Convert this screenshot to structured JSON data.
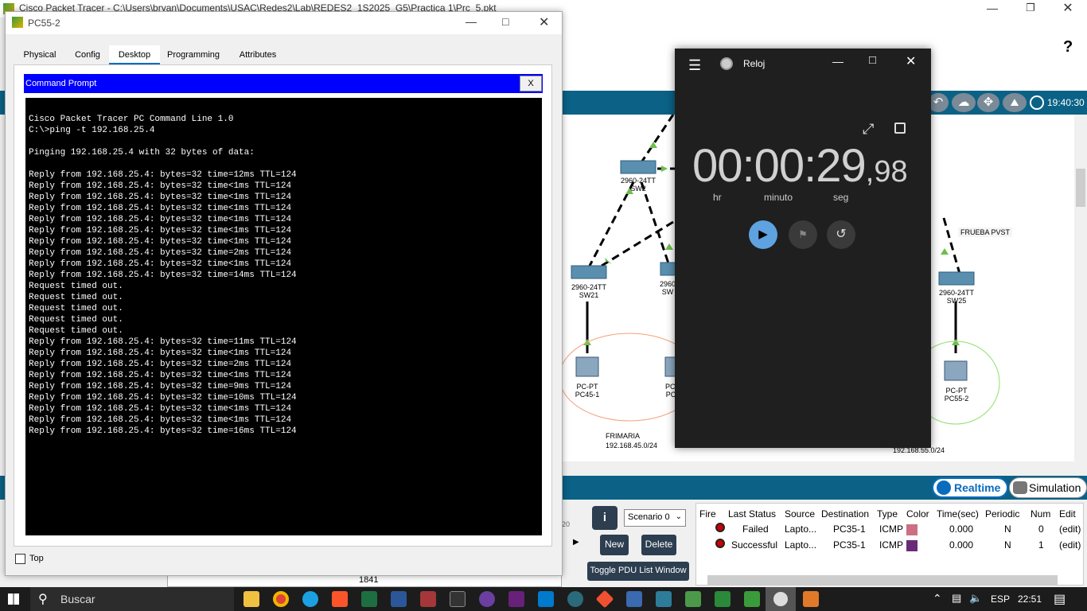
{
  "main_window": {
    "title": "Cisco Packet Tracer - C:\\Users\\bryan\\Documents\\USAC\\Redes2\\Lab\\REDES2_1S2025_G5\\Practica 1\\Prc_5.pkt",
    "help_label": "?",
    "time_display": "19:40:30",
    "realtime_label": "Realtime",
    "simulation_label": "Simulation",
    "device_count": "1841"
  },
  "topology": {
    "switches": [
      {
        "model": "2960-24TT",
        "name": "SW2"
      },
      {
        "model": "2960-24TT",
        "name": "SW21"
      },
      {
        "model": "2960",
        "name": "SW"
      },
      {
        "model": "2960-24TT",
        "name": "SW25"
      }
    ],
    "pcs": [
      {
        "model": "PC-PT",
        "name": "PC45-1"
      },
      {
        "model": "PC-PT",
        "name": "PC"
      },
      {
        "model": "PC-PT",
        "name": "PC55-2"
      }
    ],
    "notes": [
      "FRUEBA PVST",
      "FRIMARIA",
      "192.168.45.0/24",
      "192.168.55.0/24"
    ],
    "partial_label": "T"
  },
  "pc_window": {
    "title": "PC55-2",
    "tabs": [
      "Physical",
      "Config",
      "Desktop",
      "Programming",
      "Attributes"
    ],
    "active_tab": "Desktop",
    "cmd_title": "Command Prompt",
    "cmd_close": "X",
    "top_label": "Top",
    "lines": [
      "Cisco Packet Tracer PC Command Line 1.0",
      "C:\\>ping -t 192.168.25.4",
      "",
      "Pinging 192.168.25.4 with 32 bytes of data:",
      "",
      "Reply from 192.168.25.4: bytes=32 time=12ms TTL=124",
      "Reply from 192.168.25.4: bytes=32 time<1ms TTL=124",
      "Reply from 192.168.25.4: bytes=32 time<1ms TTL=124",
      "Reply from 192.168.25.4: bytes=32 time<1ms TTL=124",
      "Reply from 192.168.25.4: bytes=32 time<1ms TTL=124",
      "Reply from 192.168.25.4: bytes=32 time<1ms TTL=124",
      "Reply from 192.168.25.4: bytes=32 time<1ms TTL=124",
      "Reply from 192.168.25.4: bytes=32 time=2ms TTL=124",
      "Reply from 192.168.25.4: bytes=32 time<1ms TTL=124",
      "Reply from 192.168.25.4: bytes=32 time=14ms TTL=124",
      "Request timed out.",
      "Request timed out.",
      "Request timed out.",
      "Request timed out.",
      "Request timed out.",
      "Reply from 192.168.25.4: bytes=32 time=11ms TTL=124",
      "Reply from 192.168.25.4: bytes=32 time<1ms TTL=124",
      "Reply from 192.168.25.4: bytes=32 time=2ms TTL=124",
      "Reply from 192.168.25.4: bytes=32 time<1ms TTL=124",
      "Reply from 192.168.25.4: bytes=32 time=9ms TTL=124",
      "Reply from 192.168.25.4: bytes=32 time=10ms TTL=124",
      "Reply from 192.168.25.4: bytes=32 time<1ms TTL=124",
      "Reply from 192.168.25.4: bytes=32 time<1ms TTL=124",
      "Reply from 192.168.25.4: bytes=32 time=16ms TTL=124"
    ]
  },
  "clock_app": {
    "title": "Reloj",
    "main": "00:00:29",
    "fraction": ",98",
    "units": [
      "hr",
      "minuto",
      "seg"
    ]
  },
  "pdu_panel": {
    "scenario": "Scenario 0",
    "new_label": "New",
    "delete_label": "Delete",
    "toggle_label": "Toggle PDU List Window",
    "headers": [
      "Fire",
      "Last Status",
      "Source",
      "Destination",
      "Type",
      "Color",
      "Time(sec)",
      "Periodic",
      "Num",
      "Edit"
    ],
    "rows": [
      {
        "status": "Failed",
        "source": "Lapto...",
        "destination": "PC35-1",
        "type": "ICMP",
        "color": "#cc6f85",
        "time": "0.000",
        "periodic": "N",
        "num": "0",
        "edit": "(edit)"
      },
      {
        "status": "Successful",
        "source": "Lapto...",
        "destination": "PC35-1",
        "type": "ICMP",
        "color": "#6b2a78",
        "time": "0.000",
        "periodic": "N",
        "num": "1",
        "edit": "(edit)"
      }
    ],
    "side_label": "20"
  },
  "taskbar": {
    "search_placeholder": "Buscar",
    "lang": "ESP",
    "time": "22:51"
  }
}
